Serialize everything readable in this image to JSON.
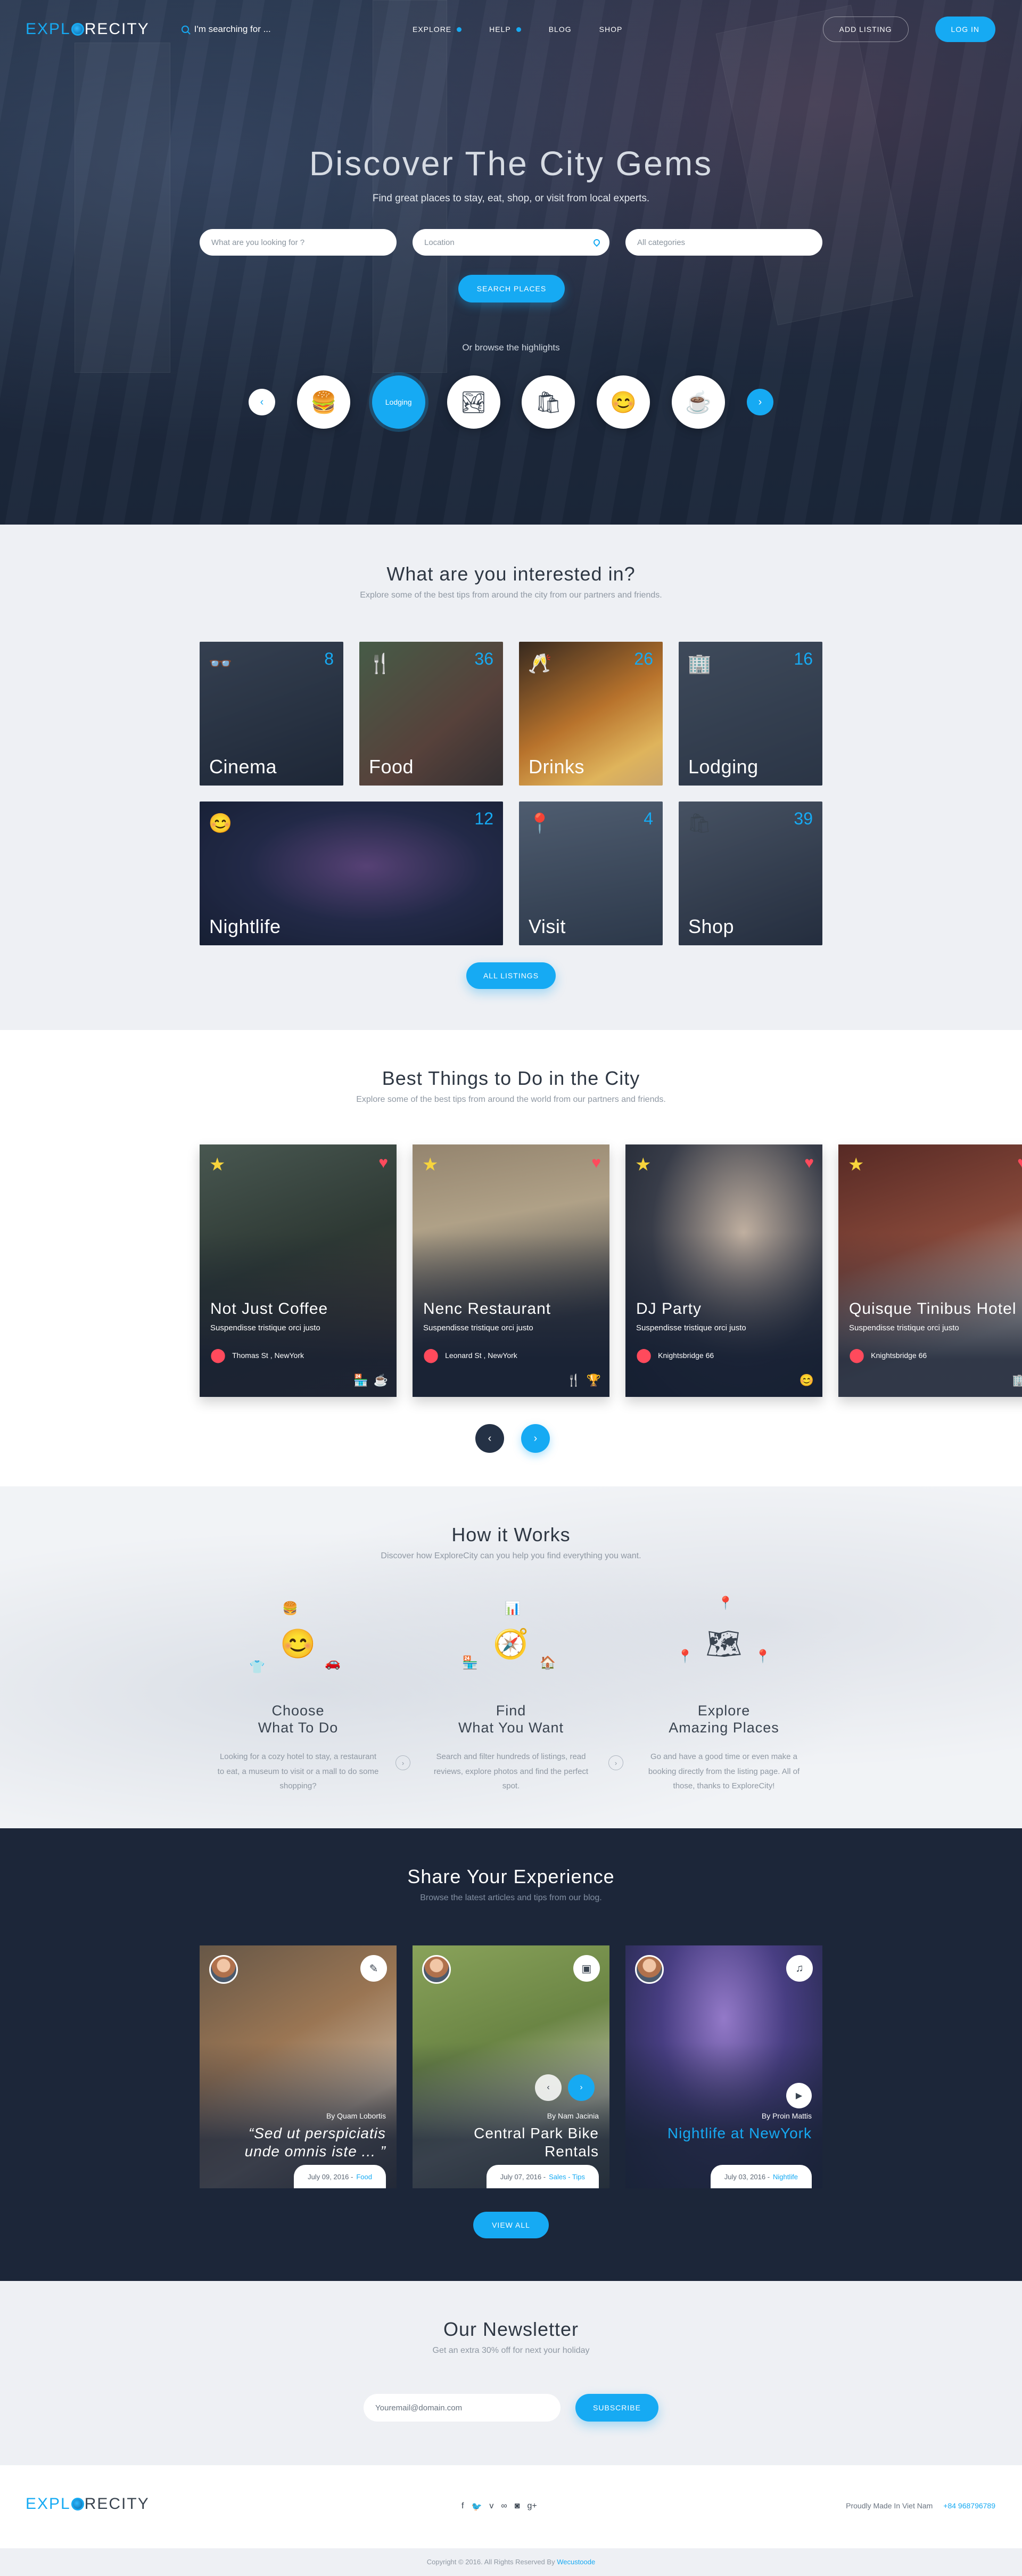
{
  "brand": {
    "part1": "EXPL",
    "part2": "RECITY"
  },
  "topbar": {
    "search_placeholder": "I'm searching for ...",
    "nav": [
      "EXPLORE",
      "HELP",
      "BLOG",
      "SHOP"
    ],
    "add_listing": "ADD LISTING",
    "login": "LOG IN"
  },
  "hero": {
    "title": "Discover The City Gems",
    "subtitle": "Find great places to stay, eat, shop, or visit from local experts.",
    "what_placeholder": "What are you looking for ?",
    "location_placeholder": "Location",
    "categories_placeholder": "All categories",
    "search_button": "SEARCH PLACES",
    "browse_label": "Or browse the highlights",
    "highlights": [
      "food-icon",
      "Lodging",
      "image-icon",
      "shop-icon",
      "smiley-icon",
      "coffee-icon"
    ]
  },
  "interests": {
    "title": "What are you interested in?",
    "subtitle": "Explore some of the best tips from around the city from our partners and friends.",
    "categories": [
      {
        "name": "Cinema",
        "count": "8",
        "icon": "glasses-icon"
      },
      {
        "name": "Food",
        "count": "36",
        "icon": "cutlery-icon"
      },
      {
        "name": "Drinks",
        "count": "26",
        "icon": "glass-icon"
      },
      {
        "name": "Lodging",
        "count": "16",
        "icon": "building-icon"
      },
      {
        "name": "Nightlife",
        "count": "12",
        "icon": "smiley-icon"
      },
      {
        "name": "Visit",
        "count": "4",
        "icon": "pin-icon"
      },
      {
        "name": "Shop",
        "count": "39",
        "icon": "bag-icon"
      }
    ],
    "all_button": "ALL LISTINGS"
  },
  "best": {
    "title": "Best Things to Do in the City",
    "subtitle": "Explore some of the best tips from around the world from our partners and friends.",
    "cards": [
      {
        "title": "Not Just Coffee",
        "desc": "Suspendisse tristique orci justo",
        "location": "Thomas St , NewYork"
      },
      {
        "title": "Nenc Restaurant",
        "desc": "Suspendisse tristique orci justo",
        "location": "Leonard St , NewYork"
      },
      {
        "title": "DJ Party",
        "desc": "Suspendisse tristique orci justo",
        "location": "Knightsbridge 66"
      },
      {
        "title": "Quisque Tinibus Hotel",
        "desc": "Suspendisse tristique orci justo",
        "location": "Knightsbridge 66"
      }
    ]
  },
  "how": {
    "title": "How it Works",
    "subtitle": "Discover how ExploreCity can you help you find everything you want.",
    "steps": [
      {
        "line1": "Choose",
        "line2": "What To Do",
        "text": "Looking for a cozy hotel to stay, a restaurant to eat, a museum to visit or a mall to do some shopping?"
      },
      {
        "line1": "Find",
        "line2": "What You Want",
        "text": "Search and filter hundreds of listings, read reviews, explore photos and find the perfect spot."
      },
      {
        "line1": "Explore",
        "line2": "Amazing Places",
        "text": "Go and have a good time or even make a booking directly from the listing page. All of those, thanks to ExploreCity!"
      }
    ]
  },
  "share": {
    "title": "Share Your Experience",
    "subtitle": "Browse the latest articles and tips from our blog.",
    "posts": [
      {
        "author": "By Quam Lobortis",
        "title": "“Sed ut perspiciatis unde omnis iste ... ”",
        "date": "July 09, 2016 -",
        "tag": "Food"
      },
      {
        "author": "By Nam Jacinia",
        "title": "Central Park Bike Rentals",
        "date": "July 07, 2016 -",
        "tag": "Sales - Tips"
      },
      {
        "author": "By Proin Mattis",
        "title": "Nightlife at NewYork",
        "date": "July 03, 2016 -",
        "tag": "Nightlife"
      }
    ],
    "view_all": "VIEW ALL"
  },
  "newsletter": {
    "title": "Our Newsletter",
    "subtitle": "Get an extra 30% off for next your holiday",
    "email_value": "Youremail@domain.com",
    "subscribe": "SUBSCRIBE"
  },
  "footer": {
    "made_in": "Proudly Made In Viet Nam",
    "phone": "+84 968796789",
    "copyright": "Copyright © 2016. All Rights Reserved By",
    "company": "Wecustoode"
  },
  "colors": {
    "accent": "#16aaf3",
    "dark": "#1c2639",
    "light_bg": "#eef0f4",
    "heart": "#ff4a5c",
    "star": "#f7d43c"
  }
}
